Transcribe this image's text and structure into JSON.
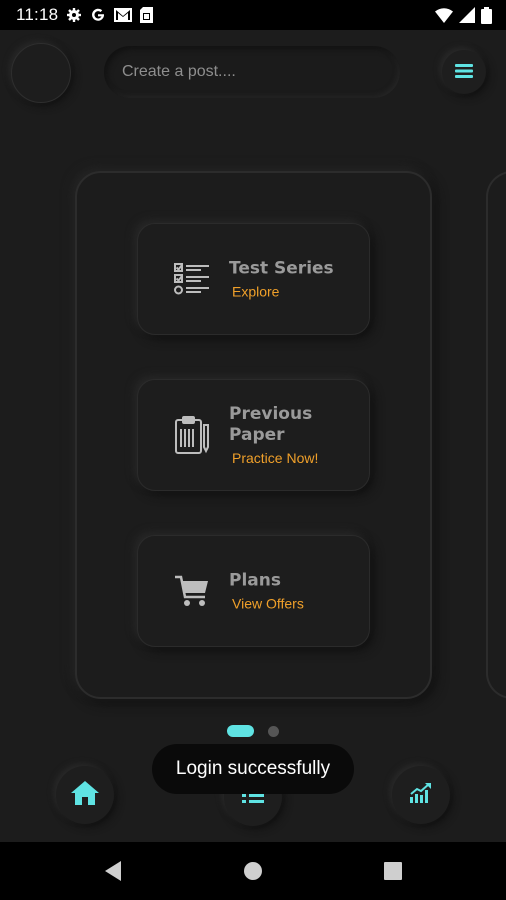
{
  "status_bar": {
    "time": "11:18",
    "left_icons": [
      "gear-icon",
      "google-icon",
      "gmail-icon",
      "sim-card-icon"
    ],
    "right_icons": [
      "wifi-icon",
      "signal-icon",
      "battery-icon"
    ]
  },
  "header": {
    "post_placeholder": "Create a post....",
    "accent_color": "#5fe3e3"
  },
  "menu_tiles": [
    {
      "title_line1": "Test Series",
      "title_line2": "",
      "subtitle": "Explore",
      "icon": "checklist-icon"
    },
    {
      "title_line1": "Previous",
      "title_line2": "Paper",
      "subtitle": "Practice Now!",
      "icon": "clipboard-icon"
    },
    {
      "title_line1": "Plans",
      "title_line2": "",
      "subtitle": "View Offers",
      "icon": "cart-icon"
    }
  ],
  "carousel": {
    "pages": 2,
    "active_page": 1
  },
  "toast": {
    "message": "Login successfully"
  },
  "bottom_nav": [
    {
      "icon": "home-icon",
      "active": true
    },
    {
      "icon": "list-icon",
      "active": false
    },
    {
      "icon": "chart-icon",
      "active": false
    }
  ],
  "colors": {
    "accent": "#5fe3e3",
    "subtitle": "#f0a02a",
    "background": "#1c1c1c"
  }
}
